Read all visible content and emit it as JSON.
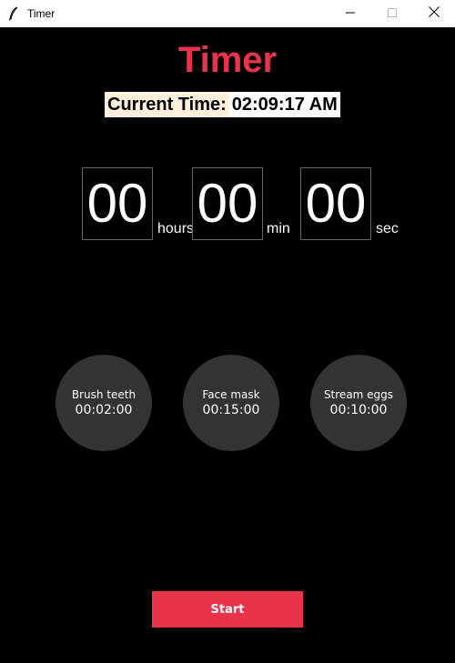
{
  "window": {
    "title": "Timer",
    "icon": "feather-icon",
    "controls": [
      "minimize-icon",
      "maximize-icon",
      "close-icon"
    ]
  },
  "app": {
    "title": "Timer",
    "current_time_label": "Current Time:",
    "current_time_value": "02:09:17 AM"
  },
  "timer": {
    "hours": "00",
    "minutes": "00",
    "seconds": "00",
    "hours_unit": "hours",
    "minutes_unit": "min",
    "seconds_unit": "sec"
  },
  "presets": [
    {
      "name": "Brush teeth",
      "time": "00:02:00"
    },
    {
      "name": "Face mask",
      "time": "00:15:00"
    },
    {
      "name": "Stream eggs",
      "time": "00:10:00"
    }
  ],
  "start_label": "Start",
  "colors": {
    "accent": "#e8344a",
    "background": "#000000",
    "preset_bg": "#333333",
    "label_bg": "#fff0dc"
  }
}
